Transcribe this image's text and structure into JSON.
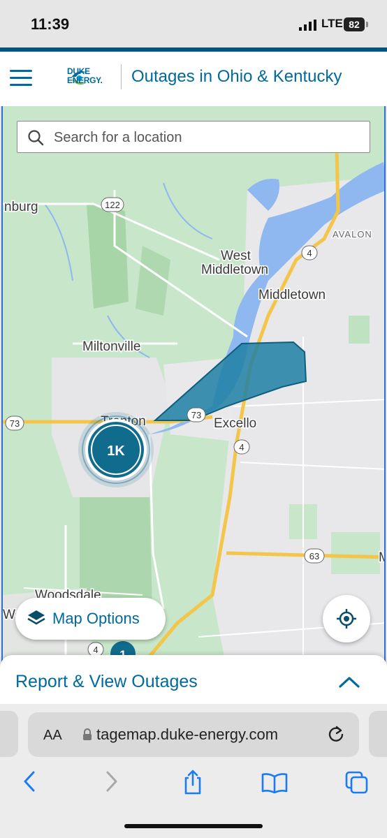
{
  "status": {
    "time": "11:39",
    "network": "LTE",
    "battery": "82"
  },
  "header": {
    "logo_line1": "DUKE",
    "logo_line2": "ENERGY.",
    "title": "Outages in Ohio & Kentucky"
  },
  "search": {
    "placeholder": "Search for a location"
  },
  "map": {
    "places": [
      "West",
      "Middletown",
      "Middletown",
      "Miltonville",
      "Excello",
      "Trenton",
      "Woodsdale",
      "AVALON",
      "nburg",
      "Wo",
      "M"
    ],
    "routes": [
      "122",
      "4",
      "73",
      "73",
      "4",
      "63",
      "4"
    ],
    "cluster_label": "1K",
    "small_cluster_label": "1",
    "colors": {
      "land": "#c8e6c9",
      "urban": "#e8e8ea",
      "water": "#8fb8f0",
      "highway": "#f3c548",
      "outage_polygon": "#1d7fa3",
      "cluster": "#106c8c"
    }
  },
  "controls": {
    "map_options_label": "Map Options",
    "locate_icon": "crosshair-icon"
  },
  "report": {
    "label": "Report & View Outages"
  },
  "browser": {
    "aa_label": "AA",
    "url": "tagemap.duke-energy.com"
  }
}
